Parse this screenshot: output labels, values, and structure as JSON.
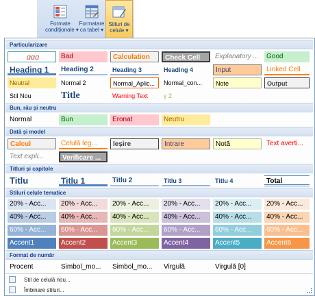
{
  "ribbon": {
    "buttons": [
      {
        "line1": "Formate",
        "line2": "condiționale ▾",
        "icon": "conditional-format-icon",
        "active": false
      },
      {
        "line1": "Formatare",
        "line2": "ca tabel ▾",
        "icon": "table-format-icon",
        "active": false
      },
      {
        "line1": "Stiluri de",
        "line2": "celule ▾",
        "icon": "cell-styles-icon",
        "active": true
      }
    ]
  },
  "sections": {
    "s1": "Particularizare",
    "s2": "Bun, rău și neutru",
    "s3": "Dată și model",
    "s4": "Titluri și capitole",
    "s5": "Stiluri celule tematice",
    "s6": "Format de număr"
  },
  "rows": {
    "custom1": [
      "ɑɑɑ",
      "Bad",
      "Calculation",
      "Check Cell",
      "Explanatory ...",
      "Good"
    ],
    "custom2": [
      "Heading 1",
      "Heading 2",
      "Heading 3",
      "Heading 4",
      "Input",
      "Linked Cell"
    ],
    "custom3": [
      "Neutral",
      "Normal 2",
      "Normal_Aplic...",
      "Normal_con...",
      "Note",
      "Output"
    ],
    "custom4": [
      "Stil Nou",
      "Title",
      "Warning Text",
      "y 2"
    ],
    "goodbad": [
      "Normal",
      "Bun",
      "Eronat",
      "Neutru"
    ],
    "data1": [
      "Calcul",
      "Celulă leg...",
      "Ieșire",
      "Intrare",
      "Notă",
      "Text averti..."
    ],
    "data2": [
      "Text expli...",
      "Verificare ..."
    ],
    "titles": [
      "Titlu",
      "Titlu 1",
      "Titlu 2",
      "Titlu 3",
      "Titlu 4",
      "Total"
    ],
    "theme20": [
      "20% - Acc...",
      "20% - Acc...",
      "20% - Acc...",
      "20% - Acc...",
      "20% - Acc...",
      "20% - Acc..."
    ],
    "theme40": [
      "40% - Acc...",
      "40% - Acc...",
      "40% - Acc...",
      "40% - Acc...",
      "40% - Acc...",
      "40% - Acc..."
    ],
    "theme60": [
      "60% - Acc...",
      "60% - Acc...",
      "60% - Acc...",
      "60% - Acc...",
      "60% - Acc...",
      "60% - Acc..."
    ],
    "accent": [
      "Accent1",
      "Accent2",
      "Accent3",
      "Accent4",
      "Accent5",
      "Accent6"
    ],
    "number": [
      "Procent",
      "Simbol_mo...",
      "Simbol_mo...",
      "Virgulă",
      "Virgulă [0]"
    ]
  },
  "footer": {
    "new_style": "Stil de celulă nou...",
    "merge_styles": "Îmbinare stiluri..."
  },
  "colors": {
    "accent1": "#4f81bd",
    "accent2": "#c0504d",
    "accent3": "#9bbb59",
    "accent4": "#8064a2",
    "accent5": "#4bacc6",
    "accent6": "#f79646",
    "good_fill": "#c6efce",
    "bad_fill": "#ffc7ce",
    "neutral_fill": "#ffeb9c"
  }
}
